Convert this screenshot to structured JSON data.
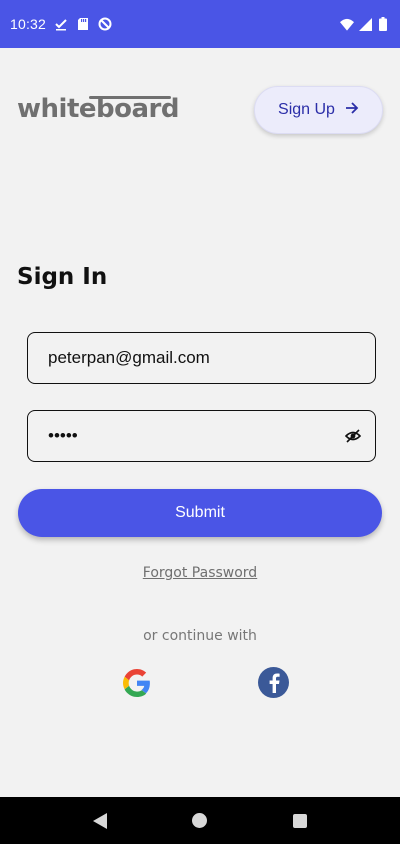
{
  "status_bar": {
    "time": "10:32",
    "icons": [
      "check-download-icon",
      "sd-card-icon",
      "sync-disabled-icon"
    ],
    "right_icons": [
      "wifi-icon",
      "signal-icon",
      "battery-icon"
    ]
  },
  "header": {
    "logo_text": "whiteboard",
    "signup_label": "Sign Up",
    "signup_icon": "arrow-right-icon"
  },
  "form": {
    "title": "Sign In",
    "email_value": "peterpan@gmail.com",
    "password_value": "•••••",
    "password_toggle_icon": "eye-off-icon",
    "submit_label": "Submit",
    "forgot_label": "Forgot Password",
    "continue_label": "or continue with"
  },
  "social": {
    "google_icon": "google-icon",
    "facebook_icon": "facebook-icon"
  },
  "nav": {
    "back_icon": "back-icon",
    "home_icon": "home-icon",
    "recents_icon": "recents-icon"
  },
  "colors": {
    "primary": "#4a55e6",
    "background": "#f2f2f2",
    "signup_bg": "#ececfb",
    "logo": "#707070",
    "facebook": "#3b5998"
  }
}
